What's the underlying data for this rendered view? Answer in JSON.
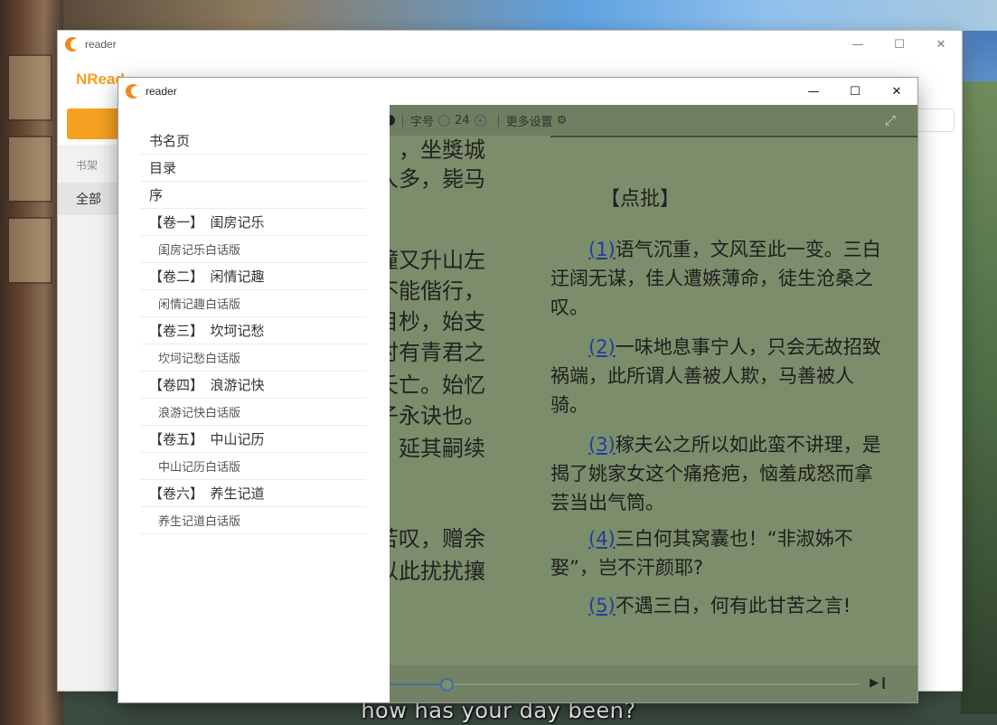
{
  "background": {
    "subtitle": "how has your day been?"
  },
  "back_window": {
    "title": "reader",
    "brand": "NRead",
    "sidebar_section": "书架",
    "sidebar_all": "全部"
  },
  "front_window": {
    "title": "reader",
    "toc": [
      {
        "label": "书名页",
        "type": "top"
      },
      {
        "label": "目录",
        "type": "top"
      },
      {
        "label": "序",
        "type": "top"
      },
      {
        "label": "【卷一】　闺房记乐",
        "type": "volume"
      },
      {
        "label": "闺房记乐白话版",
        "type": "sub"
      },
      {
        "label": "【卷二】　闲情记趣",
        "type": "volume"
      },
      {
        "label": "闲情记趣白话版",
        "type": "sub"
      },
      {
        "label": "【卷三】　坎坷记愁",
        "type": "volume"
      },
      {
        "label": "坎坷记愁白话版",
        "type": "sub"
      },
      {
        "label": "【卷四】　浪游记快",
        "type": "volume"
      },
      {
        "label": "浪游记快白话版",
        "type": "sub"
      },
      {
        "label": "【卷五】　中山记历",
        "type": "volume"
      },
      {
        "label": "中山记历白话版",
        "type": "sub"
      },
      {
        "label": "【卷六】　养生记道",
        "type": "volume"
      },
      {
        "label": "养生记道白话版",
        "type": "sub"
      }
    ],
    "toolbar": {
      "font_size_label": "字号",
      "font_size_value": "24",
      "more_settings": "更多设置"
    },
    "left_column_fragments": [
      "，坐獎城",
      "人多，毙马",
      "撞又升山左",
      "不能偕行，",
      "目杪，始支",
      "时有青君之",
      "夭亡。始忆",
      "子永诀也。",
      "，延其嗣续",
      "苦叹，赠余",
      "以此扰扰攘"
    ],
    "section_title": "【点批】",
    "notes": [
      {
        "ref": "(1)",
        "text": "语气沉重，文风至此一变。三白迂阔无谋，佳人遭嫉薄命，徒生沧桑之叹。"
      },
      {
        "ref": "(2)",
        "text": "一味地息事宁人，只会无故招致祸端，此所谓人善被人欺，马善被人骑。"
      },
      {
        "ref": "(3)",
        "text": "稼夫公之所以如此蛮不讲理，是揭了姚家女这个痛疮疤，恼羞成怒而拿芸当出气筒。"
      },
      {
        "ref": "(4)",
        "text": "三白何其窝囊也！“非淑姊不娶”，岂不汗颜耶?"
      },
      {
        "ref": "(5)",
        "text": "不遇三白，何有此甘苦之言!"
      }
    ],
    "progress": {
      "fraction": 0.12
    }
  }
}
